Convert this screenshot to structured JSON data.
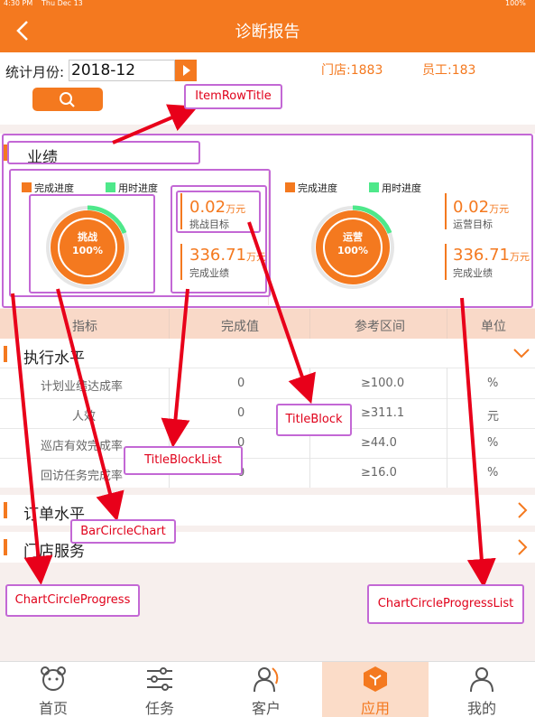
{
  "status": {
    "time": "4:30 PM",
    "date": "Thu Dec 13",
    "battery": "100%"
  },
  "nav": {
    "title": "诊断报告"
  },
  "filter": {
    "month_label": "统计月份:",
    "month_value": "2018-12",
    "store": "门店:1883",
    "staff": "员工:183"
  },
  "performance": {
    "title": "业绩",
    "legend": [
      "完成进度",
      "用时进度"
    ],
    "cards": [
      {
        "circle_label": "挑战",
        "percent": "100%",
        "progress": 1.0,
        "time_progress": 0.3,
        "target_value": "0.02",
        "target_unit": "万元",
        "target_label": "挑战目标",
        "done_value": "336.71",
        "done_unit": "万元",
        "done_label": "完成业绩"
      },
      {
        "circle_label": "运营",
        "percent": "100%",
        "progress": 1.0,
        "time_progress": 0.3,
        "target_value": "0.02",
        "target_unit": "万元",
        "target_label": "运营目标",
        "done_value": "336.71",
        "done_unit": "万元",
        "done_label": "完成业绩"
      }
    ]
  },
  "table": {
    "headers": [
      "指标",
      "完成值",
      "参考区间",
      "单位"
    ],
    "group": "执行水平",
    "rows": [
      {
        "name": "计划业绩达成率",
        "value": "0",
        "range": "≥100.0",
        "unit": "%"
      },
      {
        "name": "人效",
        "value": "0",
        "range": "≥311.1",
        "unit": "元"
      },
      {
        "name": "巡店有效完成率",
        "value": "0",
        "range": "≥44.0",
        "unit": "%"
      },
      {
        "name": "回访任务完成率",
        "value": "0",
        "range": "≥16.0",
        "unit": "%"
      }
    ]
  },
  "sections": [
    "订单水平",
    "门店服务"
  ],
  "tabs": [
    {
      "label": "首页"
    },
    {
      "label": "任务"
    },
    {
      "label": "客户"
    },
    {
      "label": "应用"
    },
    {
      "label": "我的"
    }
  ],
  "annotations": {
    "item_row_title": "ItemRowTitle",
    "title_block": "TitleBlock",
    "title_block_list": "TitleBlockList",
    "bar_circle_chart": "BarCircleChart",
    "chart_circle_progress": "ChartCircleProgress",
    "chart_circle_progress_list": "ChartCircleProgressList"
  },
  "colors": {
    "accent": "#f4791f",
    "green": "#4ee88a",
    "annotation": "#c368d5",
    "arrow": "#e8001a"
  }
}
